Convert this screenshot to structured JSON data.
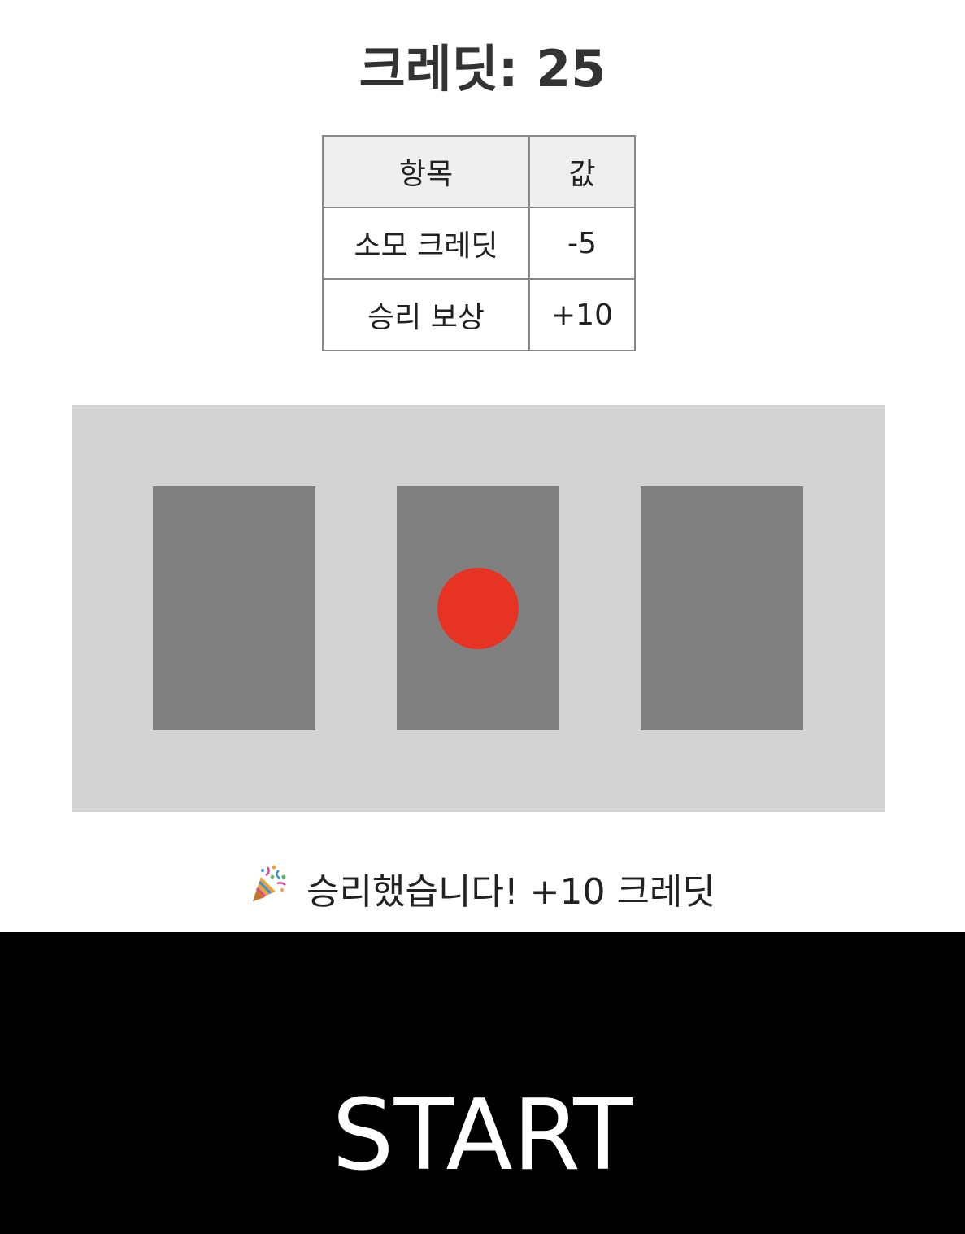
{
  "header": {
    "credit_text": "크레딧: 25"
  },
  "info_table": {
    "headers": [
      "항목",
      "값"
    ],
    "rows": [
      [
        "소모 크레딧",
        "-5"
      ],
      [
        "승리 보상",
        "+10"
      ]
    ]
  },
  "slot_machine": {
    "background_color": "#d3d3d3",
    "reel_color": "#808080",
    "reels": [
      {
        "symbol": "none"
      },
      {
        "symbol": "red-circle",
        "color": "#e63323"
      },
      {
        "symbol": "none"
      }
    ]
  },
  "result": {
    "icon": "party-popper-icon",
    "message": "승리했습니다! +10 크레딧"
  },
  "start_button": {
    "label": "START"
  }
}
